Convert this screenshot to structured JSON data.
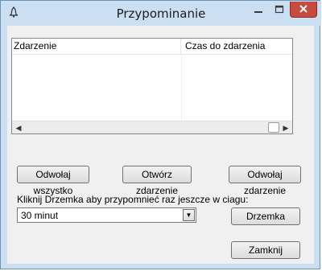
{
  "window": {
    "title": "Przypominanie"
  },
  "listview": {
    "columns": [
      "Zdarzenie",
      "Czas do zdarzenia"
    ],
    "rows": []
  },
  "buttons": {
    "dismiss_all": "Odwołaj wszystko",
    "open_event": "Otwórz zdarzenie",
    "dismiss_event": "Odwołaj zdarzenie",
    "snooze": "Drzemka",
    "close": "Zamknij"
  },
  "snooze": {
    "instruction": "Kliknij Drzemka aby przypomnieć raz jeszcze w ciagu:",
    "selected": "30 minut"
  },
  "icons": {
    "app": "bell-icon",
    "minimize": "minimize-icon",
    "maximize": "maximize-icon",
    "close": "close-icon",
    "dropdown": "chevron-down-icon"
  },
  "colors": {
    "frame": "#cbdff2",
    "close_button": "#c74a3e",
    "client": "#f0f0f0"
  }
}
